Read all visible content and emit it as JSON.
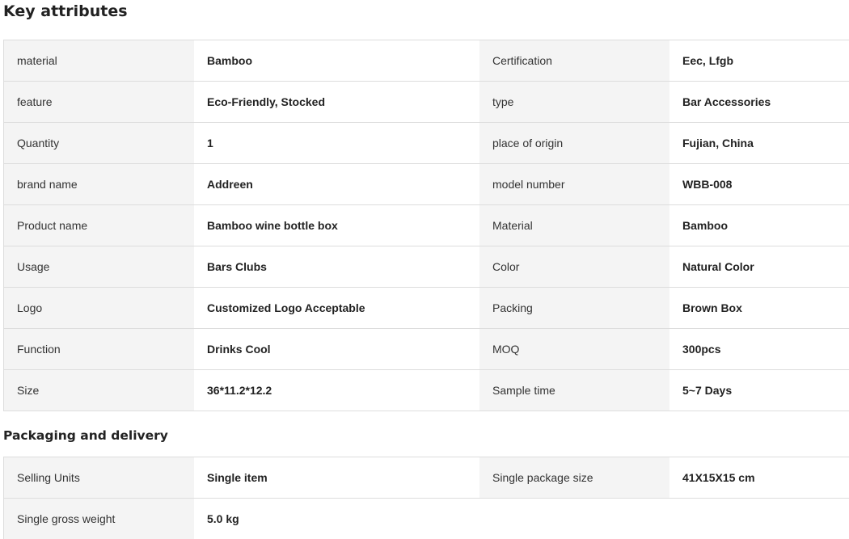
{
  "key_attributes": {
    "title": "Key attributes",
    "rows": [
      {
        "k1": "material",
        "v1": "Bamboo",
        "k2": "Certification",
        "v2": "Eec, Lfgb"
      },
      {
        "k1": "feature",
        "v1": "Eco-Friendly, Stocked",
        "k2": "type",
        "v2": "Bar Accessories"
      },
      {
        "k1": "Quantity",
        "v1": "1",
        "k2": "place of origin",
        "v2": "Fujian, China"
      },
      {
        "k1": "brand name",
        "v1": "Addreen",
        "k2": "model number",
        "v2": "WBB-008"
      },
      {
        "k1": "Product name",
        "v1": "Bamboo wine bottle box",
        "k2": "Material",
        "v2": "Bamboo"
      },
      {
        "k1": "Usage",
        "v1": "Bars Clubs",
        "k2": "Color",
        "v2": "Natural Color"
      },
      {
        "k1": "Logo",
        "v1": "Customized Logo Acceptable",
        "k2": "Packing",
        "v2": "Brown Box"
      },
      {
        "k1": "Function",
        "v1": "Drinks Cool",
        "k2": "MOQ",
        "v2": "300pcs"
      },
      {
        "k1": "Size",
        "v1": "36*11.2*12.2",
        "k2": "Sample time",
        "v2": "5~7 Days"
      }
    ]
  },
  "packaging_delivery": {
    "title": "Packaging and delivery",
    "rows": [
      {
        "k1": "Selling Units",
        "v1": "Single item",
        "k2": "Single package size",
        "v2": "41X15X15 cm"
      },
      {
        "k1": "Single gross weight",
        "v1": "5.0 kg",
        "k2": "",
        "v2": ""
      }
    ]
  }
}
